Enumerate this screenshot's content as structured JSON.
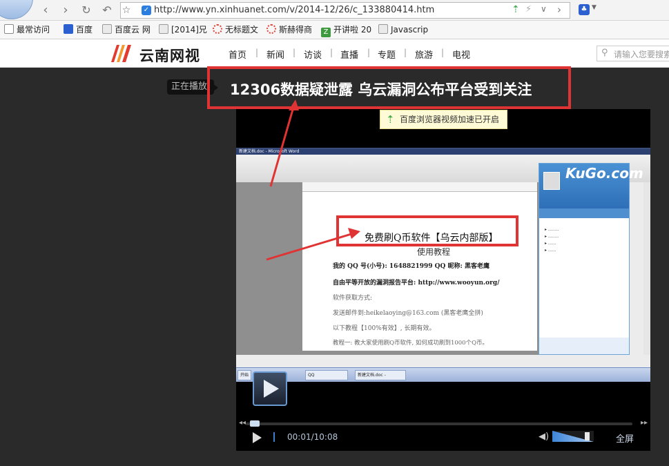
{
  "browser": {
    "url": "http://www.yn.xinhuanet.com/v/2014-12/26/c_133880414.htm",
    "bookmarks": [
      "最常访问",
      "百度",
      "百度云 网",
      "[2014]兄",
      "无标题文",
      "斯赫得商",
      "开讲啦 20",
      "Javascrip"
    ]
  },
  "site": {
    "logo_text": "云南网视",
    "nav": [
      "首页",
      "新闻",
      "访谈",
      "直播",
      "专题",
      "旅游",
      "电视"
    ],
    "search_placeholder": "请输入您要搜索"
  },
  "video": {
    "now_playing_label": "正在播放",
    "title": "12306数据疑泄露 乌云漏洞公布平台受到关注",
    "accel_tip": "百度浏览器视频加速已开启",
    "current_time": "00:01/10:08",
    "progress": 0.002,
    "volume": 0.85,
    "fullscreen_label": "全屏"
  },
  "video_frame": {
    "word_title": "新建文档.doc - Microsoft Word",
    "heading": "免费刷Q币软件【乌云内部版】",
    "subheading": "使用教程",
    "lines": [
      "我的 QQ 号(小号): 1648821999    QQ 昵称: 黑客老鹰",
      "自由平等开放的漏洞报告平台: http://www.wooyun.org/",
      "软件获取方式:",
      "发送邮件到:heikelaoying@163.com (黑客老鹰全拼)",
      "以下教程【100%有效】, 长期有效。",
      "教程一: 教大家使用刷Q币软件, 如何成功刷到1000个Q币。"
    ],
    "qq_brand": "KuGo.com",
    "taskbar_items": [
      "开始",
      "QQ",
      "新建文档.doc - "
    ]
  }
}
